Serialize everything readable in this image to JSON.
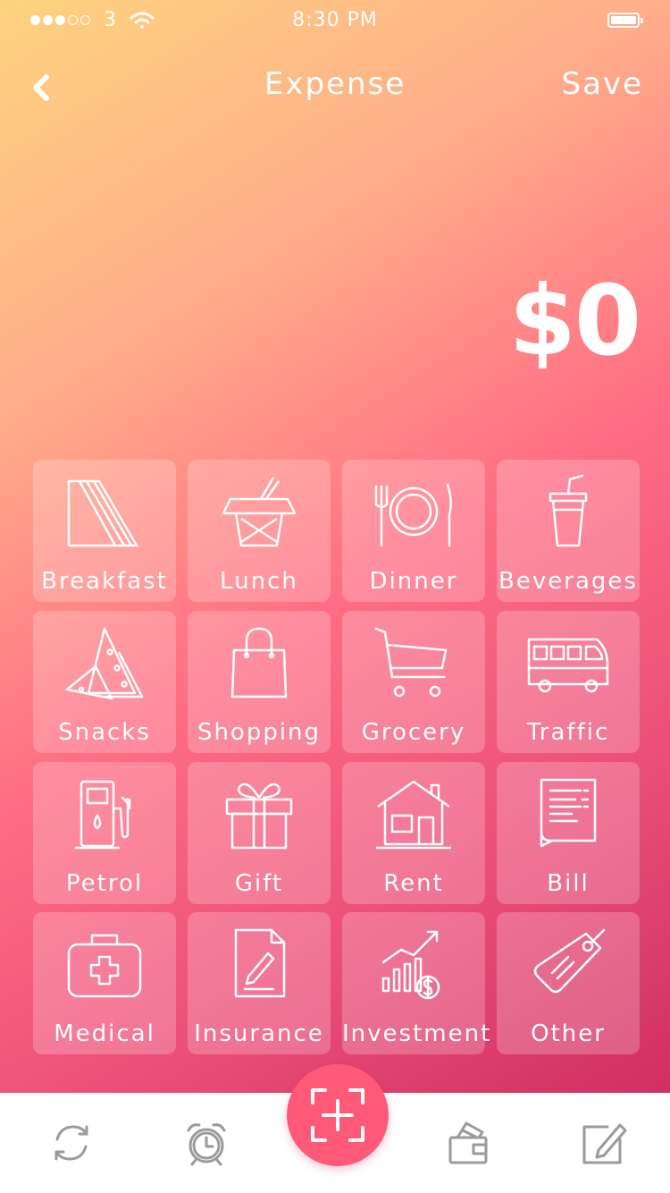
{
  "status_bar": {
    "carrier": "3",
    "time": "8:30 PM",
    "signal_filled": 3,
    "signal_total": 5,
    "battery_level": 1.0
  },
  "nav": {
    "back_icon": "chevron-left-icon",
    "title": "Expense",
    "save_label": "Save"
  },
  "amount": "$0",
  "categories": [
    {
      "label": "Breakfast",
      "icon": "sandwich-icon"
    },
    {
      "label": "Lunch",
      "icon": "takeout-box-icon"
    },
    {
      "label": "Dinner",
      "icon": "plate-cutlery-icon"
    },
    {
      "label": "Beverages",
      "icon": "drink-cup-icon"
    },
    {
      "label": "Snacks",
      "icon": "nachos-icon"
    },
    {
      "label": "Shopping",
      "icon": "shopping-bag-icon"
    },
    {
      "label": "Grocery",
      "icon": "shopping-cart-icon"
    },
    {
      "label": "Traffic",
      "icon": "bus-icon"
    },
    {
      "label": "Petrol",
      "icon": "fuel-pump-icon"
    },
    {
      "label": "Gift",
      "icon": "gift-icon"
    },
    {
      "label": "Rent",
      "icon": "house-icon"
    },
    {
      "label": "Bill",
      "icon": "bill-icon"
    },
    {
      "label": "Medical",
      "icon": "first-aid-kit-icon"
    },
    {
      "label": "Insurance",
      "icon": "document-pen-icon"
    },
    {
      "label": "Investment",
      "icon": "growth-chart-icon"
    },
    {
      "label": "Other",
      "icon": "tag-icon"
    }
  ],
  "tab_bar": {
    "items": [
      "refresh-icon",
      "alarm-clock-icon",
      "scan-icon",
      "wallet-icon",
      "edit-icon"
    ]
  },
  "colors": {
    "gradient_start": "#fdd37f",
    "gradient_mid": "#ff6e84",
    "gradient_end": "#c8265b",
    "accent": "#fe5a78",
    "tab_icon": "#9a9a9a"
  }
}
